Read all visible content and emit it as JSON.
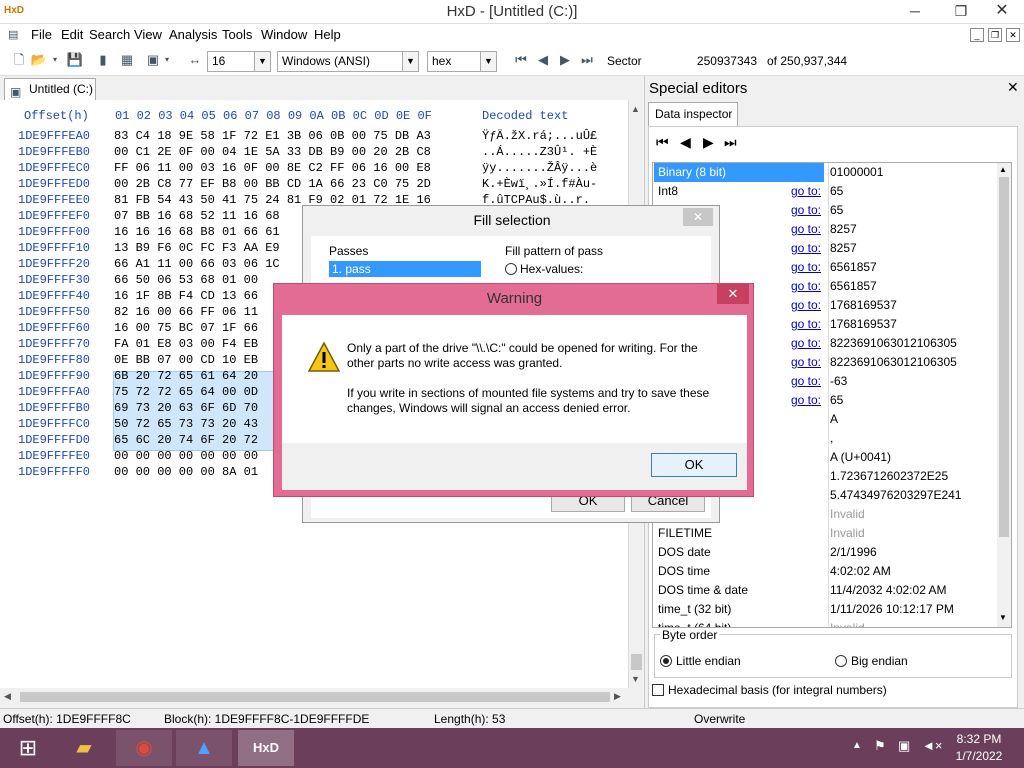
{
  "window": {
    "title": "HxD - [Untitled (C:)]",
    "app_icon": "HxD"
  },
  "menu": [
    "File",
    "Edit",
    "Search",
    "View",
    "Analysis",
    "Tools",
    "Window",
    "Help"
  ],
  "toolbar": {
    "bytes_per_row": "16",
    "charset": "Windows (ANSI)",
    "display": "hex",
    "sector_label": "Sector",
    "sector_value": "250937343",
    "sector_total": "of 250,937,344"
  },
  "tab": {
    "label": "Untitled (C:)"
  },
  "hex": {
    "header_offset": "Offset(h)",
    "header_columns": "01 02 03 04 05 06 07 08 09 0A 0B 0C 0D 0E 0F",
    "header_decoded": "Decoded text",
    "rows": [
      {
        "offset": "1DE9FFFEA0",
        "bytes": "83 C4 18 9E 58 1F 72 E1 3B 06 0B 00 75 DB A3",
        "text": "ŸƒÄ.žX.rá;...uÛ£"
      },
      {
        "offset": "1DE9FFFEB0",
        "bytes": "00 C1 2E 0F 00 04 1E 5A 33 DB B9 00 20 2B C8",
        "text": "..Á.....Z3Û¹. +È"
      },
      {
        "offset": "1DE9FFFEC0",
        "bytes": "FF 06 11 00 03 16 0F 00 8E C2 FF 06 16 00 E8",
        "text": "ÿy.......ŽÂÿ...è"
      },
      {
        "offset": "1DE9FFFED0",
        "bytes": "00 2B C8 77 EF B8 00 BB CD 1A 66 23 C0 75 2D",
        "text": "K.+Èwï¸.»Í.f#Àu-"
      },
      {
        "offset": "1DE9FFFEE0",
        "bytes": "81 FB 54 43 50 41 75 24 81 F9 02 01 72 1E 16",
        "text": "f.ûTCPAu$.ù..r."
      },
      {
        "offset": "1DE9FFFEF0",
        "bytes": "07 BB 16 68 52 11 16 68",
        "text": ""
      },
      {
        "offset": "1DE9FFFF00",
        "bytes": "16 16 16 68 B8 01 66 61",
        "text": ""
      },
      {
        "offset": "1DE9FFFF10",
        "bytes": "13 B9 F6 0C FC F3 AA E9",
        "text": ""
      },
      {
        "offset": "1DE9FFFF20",
        "bytes": "66 A1 11 00 66 03 06 1C",
        "text": ""
      },
      {
        "offset": "1DE9FFFF30",
        "bytes": "66 50 06 53 68 01 00",
        "text": ""
      },
      {
        "offset": "1DE9FFFF40",
        "bytes": "16 1F 8B F4 CD 13 66",
        "text": ""
      },
      {
        "offset": "1DE9FFFF50",
        "bytes": "82 16 00 66 FF 06 11",
        "text": ""
      },
      {
        "offset": "1DE9FFFF60",
        "bytes": "16 00 75 BC 07 1F 66",
        "text": ""
      },
      {
        "offset": "1DE9FFFF70",
        "bytes": "FA 01 E8 03 00 F4 EB",
        "text": ""
      },
      {
        "offset": "1DE9FFFF80",
        "bytes": "0E BB 07 00 CD 10 EB",
        "text": ""
      },
      {
        "offset": "1DE9FFFF90",
        "bytes": "6B 20 72 65 61 64 20",
        "text": ""
      },
      {
        "offset": "1DE9FFFFA0",
        "bytes": "75 72 72 65 64 00 0D",
        "text": ""
      },
      {
        "offset": "1DE9FFFFB0",
        "bytes": "69 73 20 63 6F 6D 70",
        "text": ""
      },
      {
        "offset": "1DE9FFFFC0",
        "bytes": "50 72 65 73 73 20 43",
        "text": ""
      },
      {
        "offset": "1DE9FFFFD0",
        "bytes": "65 6C 20 74 6F 20 72",
        "text": ""
      },
      {
        "offset": "1DE9FFFFE0",
        "bytes": "00 00 00 00 00 00 00",
        "text": ""
      },
      {
        "offset": "1DE9FFFFF0",
        "bytes": "00 00 00 00 00 8A 01",
        "text": ""
      }
    ]
  },
  "status": {
    "offset": "Offset(h): 1DE9FFFF8C",
    "block": "Block(h): 1DE9FFFF8C-1DE9FFFFDE",
    "length": "Length(h): 53",
    "mode": "Overwrite"
  },
  "special_editors": {
    "title": "Special editors",
    "tab": "Data inspector",
    "goto": "go to:",
    "rows": [
      {
        "label": "Binary (8 bit)",
        "value": "01000001",
        "goto": false,
        "selected": true
      },
      {
        "label": "Int8",
        "value": "65",
        "goto": true
      },
      {
        "label": "",
        "value": "65",
        "goto": true
      },
      {
        "label": "",
        "value": "8257",
        "goto": true
      },
      {
        "label": "",
        "value": "8257",
        "goto": true
      },
      {
        "label": "",
        "value": "6561857",
        "goto": true
      },
      {
        "label": "",
        "value": "6561857",
        "goto": true
      },
      {
        "label": "",
        "value": "1768169537",
        "goto": true
      },
      {
        "label": "",
        "value": "1768169537",
        "goto": true
      },
      {
        "label": "",
        "value": "8223691063012106305",
        "goto": true
      },
      {
        "label": "",
        "value": "8223691063012106305",
        "goto": true
      },
      {
        "label": "",
        "value": "-63",
        "goto": true
      },
      {
        "label": "",
        "value": "65",
        "goto": true
      },
      {
        "label": "",
        "value": "A",
        "goto": false
      },
      {
        "label": "t",
        "value": ",",
        "goto": false
      },
      {
        "label": "",
        "value": "A (U+0041)",
        "goto": false
      },
      {
        "label": "",
        "value": "1.7236712602372E25",
        "goto": false
      },
      {
        "label": "it)",
        "value": "5.47434976203297E241",
        "goto": false
      },
      {
        "label": "",
        "value": "Invalid",
        "goto": false,
        "dim": true
      },
      {
        "label": "FILETIME",
        "value": "Invalid",
        "goto": false,
        "dim": true
      },
      {
        "label": "DOS date",
        "value": "2/1/1996",
        "goto": false
      },
      {
        "label": "DOS time",
        "value": "4:02:02 AM",
        "goto": false
      },
      {
        "label": "DOS time & date",
        "value": "11/4/2032 4:02:02 AM",
        "goto": false
      },
      {
        "label": "time_t (32 bit)",
        "value": "1/11/2026 10:12:17 PM",
        "goto": false
      },
      {
        "label": "time_t (64 bit)",
        "value": "Invalid",
        "goto": false,
        "dim": true
      }
    ],
    "byte_order_label": "Byte order",
    "little_endian": "Little endian",
    "big_endian": "Big endian",
    "hex_basis": "Hexadecimal basis (for integral numbers)"
  },
  "fill_dialog": {
    "title": "Fill selection",
    "passes_label": "Passes",
    "pass_item": "1. pass",
    "pattern_label": "Fill pattern of pass",
    "hex_values": "Hex-values:",
    "ok": "OK",
    "cancel": "Cancel"
  },
  "warning": {
    "title": "Warning",
    "line1": "Only a part of the drive \"\\\\.\\C:\" could be opened for writing. For the",
    "line2": "other parts no write access was granted.",
    "line3": "If you write in sections of mounted file systems and try to save these",
    "line4": "changes, Windows will signal an access denied error.",
    "ok": "OK"
  },
  "clock": {
    "time": "8:32 PM",
    "date": "1/7/2022"
  },
  "colors": {
    "accent": "#3399ff",
    "warning_frame": "#e36c95",
    "taskbar": "#6b3f5c",
    "offset_blue": "#1a4ab8"
  }
}
